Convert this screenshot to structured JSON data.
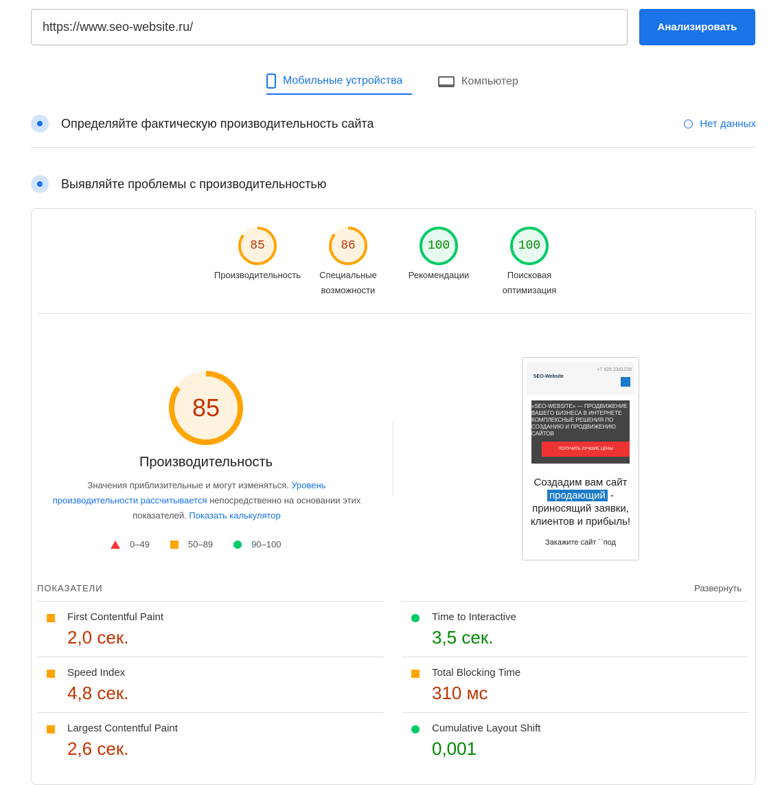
{
  "search": {
    "url": "https://www.seo-website.ru/",
    "analyze_label": "Анализировать"
  },
  "tabs": [
    {
      "label": "Мобильные устройства",
      "icon": "phone-icon"
    },
    {
      "label": "Компьютер",
      "icon": "laptop-icon"
    }
  ],
  "field_section": {
    "title": "Определяйте фактическую производительность сайта",
    "no_data": "Нет данных"
  },
  "lab_section": {
    "title": "Выявляйте проблемы с производительностью"
  },
  "gauges": [
    {
      "value": "85",
      "label": "Производительность",
      "score": 85
    },
    {
      "value": "86",
      "label": "Специальные возможности",
      "score": 86
    },
    {
      "value": "100",
      "label": "Рекомендации",
      "score": 100
    },
    {
      "value": "100",
      "label": "Поисковая оптимизация",
      "score": 100
    }
  ],
  "main_gauge": {
    "value": "85",
    "score": 85,
    "title": "Производительность",
    "desc1": "Значения приблизительные и могут изменяться. ",
    "link1": "Уровень производительности рассчитывается",
    "desc2": " непосредственно на основании этих показателей. ",
    "link2": "Показать калькулятор"
  },
  "legend": [
    "0–49",
    "50–89",
    "90–100"
  ],
  "screenshot": {
    "phone": "+7 928 2341228",
    "logo": "SEO-Website",
    "hero": "«SEO-WEBSITE» — ПРОДВИЖЕНИЕ ВАШЕГО БИЗНЕСА В ИНТЕРНЕТЕ КОМПЛЕКСНЫЕ РЕШЕНИЯ ПО СОЗДАНИЮ И ПРОДВИЖЕНИЮ САЙТОВ",
    "cta": "ПОЛУЧИТЬ ЛУЧШИЕ ЦЕНЫ",
    "h1a": "Создадим вам сайт",
    "h1b": "продающий",
    "h1c": "- приносящий заявки, клиентов и прибыль!",
    "cut": "Закажите сайт ``под"
  },
  "metrics": {
    "header": "ПОКАЗАТЕЛИ",
    "expand": "Развернуть",
    "items": [
      {
        "name": "First Contentful Paint",
        "value": "2,0 сек.",
        "status": "average"
      },
      {
        "name": "Time to Interactive",
        "value": "3,5 сек.",
        "status": "pass"
      },
      {
        "name": "Speed Index",
        "value": "4,8 сек.",
        "status": "average"
      },
      {
        "name": "Total Blocking Time",
        "value": "310 мс",
        "status": "average"
      },
      {
        "name": "Largest Contentful Paint",
        "value": "2,6 сек.",
        "status": "average"
      },
      {
        "name": "Cumulative Layout Shift",
        "value": "0,001",
        "status": "pass"
      }
    ]
  }
}
